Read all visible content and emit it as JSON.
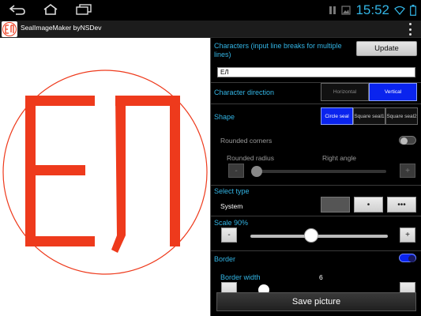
{
  "status_bar": {
    "time": "15:52",
    "icons": [
      "back-icon",
      "home-icon",
      "recent-apps-icon",
      "pause-icon",
      "image-icon",
      "wifi-icon",
      "battery-icon"
    ]
  },
  "app_bar": {
    "title": "SealImageMaker byNSDev"
  },
  "preview": {
    "seal_text": "ЕЛ",
    "seal_color": "#ee3a1c",
    "shape": "circle"
  },
  "characters": {
    "label": "Characters (input line breaks for multiple lines)",
    "update_label": "Update",
    "value": "ЕЛ"
  },
  "direction": {
    "label": "Character direction",
    "options": [
      "Horizontal",
      "Vertical"
    ],
    "selected": "Vertical"
  },
  "shape": {
    "label": "Shape",
    "options": [
      "Circle seal",
      "Square seal1",
      "Square seal2"
    ],
    "selected": "Circle seal",
    "rounded_corners_label": "Rounded corners",
    "rounded_radius_label": "Rounded radius",
    "right_angle_label": "Right angle"
  },
  "select_type": {
    "label": "Select type",
    "value": "System",
    "more_label": "•••",
    "dot_label": "•"
  },
  "scale": {
    "label": "Scale  90%",
    "value_percent": 90,
    "minus": "-",
    "plus": "+"
  },
  "border": {
    "label": "Border",
    "enabled": true,
    "width_label": "Border width",
    "width_value": "6"
  },
  "save": {
    "label": "Save picture"
  },
  "colors": {
    "accent": "#33b5e5",
    "segment_active": "#0a24ee",
    "seal": "#ee3a1c"
  }
}
